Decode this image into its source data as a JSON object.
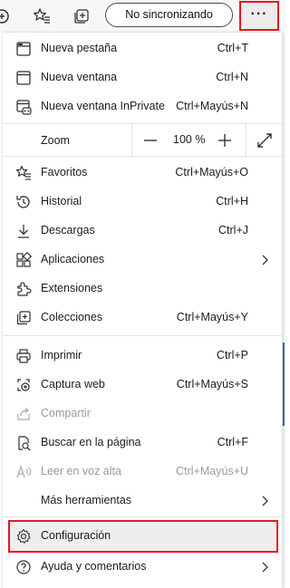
{
  "toolbar": {
    "sync_label": "No sincronizando",
    "more_label": "···"
  },
  "menu": {
    "group1": [
      {
        "label": "Nueva pestaña",
        "shortcut": "Ctrl+T",
        "icon": "new-tab-icon"
      },
      {
        "label": "Nueva ventana",
        "shortcut": "Ctrl+N",
        "icon": "new-window-icon"
      },
      {
        "label": "Nueva ventana InPrivate",
        "shortcut": "Ctrl+Mayús+N",
        "icon": "inprivate-icon"
      }
    ],
    "zoom": {
      "label": "Zoom",
      "value": "100 %"
    },
    "group2": [
      {
        "label": "Favoritos",
        "shortcut": "Ctrl+Mayús+O",
        "icon": "favorites-icon"
      },
      {
        "label": "Historial",
        "shortcut": "Ctrl+H",
        "icon": "history-icon"
      },
      {
        "label": "Descargas",
        "shortcut": "Ctrl+J",
        "icon": "download-icon"
      },
      {
        "label": "Aplicaciones",
        "shortcut": "",
        "icon": "apps-icon"
      },
      {
        "label": "Extensiones",
        "shortcut": "",
        "icon": "extensions-icon"
      },
      {
        "label": "Colecciones",
        "shortcut": "Ctrl+Mayús+Y",
        "icon": "collections-icon"
      }
    ],
    "group3": [
      {
        "label": "Imprimir",
        "shortcut": "Ctrl+P",
        "icon": "print-icon"
      },
      {
        "label": "Captura web",
        "shortcut": "Ctrl+Mayús+S",
        "icon": "web-capture-icon"
      },
      {
        "label": "Compartir",
        "shortcut": "",
        "icon": "share-icon",
        "disabled": true
      },
      {
        "label": "Buscar en la página",
        "shortcut": "Ctrl+F",
        "icon": "find-icon"
      },
      {
        "label": "Leer en voz alta",
        "shortcut": "Ctrl+Mayús+U",
        "icon": "read-aloud-icon",
        "disabled": true
      },
      {
        "label": "Más herramientas",
        "shortcut": "",
        "icon": ""
      }
    ],
    "group4": [
      {
        "label": "Configuración",
        "shortcut": "",
        "icon": "settings-icon"
      },
      {
        "label": "Ayuda y comentarios",
        "shortcut": "",
        "icon": "help-icon"
      }
    ]
  },
  "colors": {
    "highlight_border": "#e8141c",
    "accent": "#2f6fb3"
  }
}
